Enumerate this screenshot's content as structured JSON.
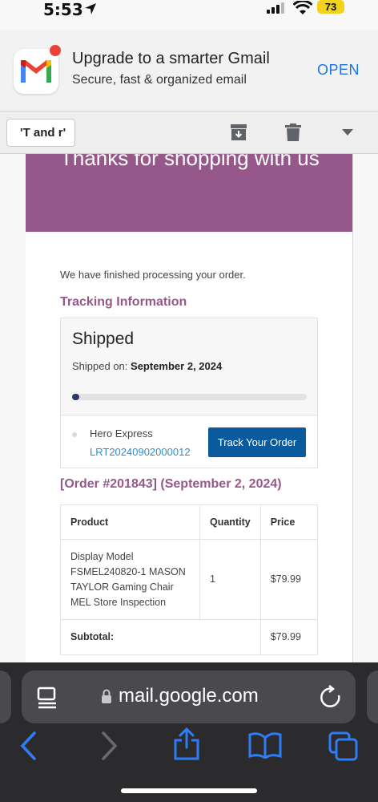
{
  "status_bar": {
    "time": "5:53",
    "battery": "73"
  },
  "app_banner": {
    "title": "Upgrade to a smarter Gmail",
    "subtitle": "Secure, fast & organized email",
    "open_label": "OPEN"
  },
  "toolbar": {
    "back_label": "'T and r'"
  },
  "email": {
    "hero_text": "Thanks for shopping with us",
    "intro": "We have finished processing your order.",
    "tracking_heading": "Tracking Information",
    "tracking": {
      "status": "Shipped",
      "shipped_on_label": "Shipped on:",
      "shipped_on_date": "September 2, 2024",
      "progress": 0.03,
      "carrier": "Hero Express",
      "tracking_number": "LRT20240902000012",
      "track_button": "Track Your Order"
    },
    "order_heading": "[Order #201843] (September 2, 2024)",
    "table": {
      "headers": [
        "Product",
        "Quantity",
        "Price"
      ],
      "rows": [
        {
          "product": "Display Model FSMEL240820-1 MASON TAYLOR Gaming Chair MEL Store Inspection",
          "quantity": "1",
          "price": "$79.99"
        }
      ],
      "subtotal_label": "Subtotal:",
      "subtotal_value": "$79.99"
    }
  },
  "browser": {
    "url": "mail.google.com"
  },
  "colors": {
    "brand_purple": "#96588a",
    "button_blue": "#0a5b9e",
    "link_blue": "#2f8fc9",
    "ios_blue": "#1a73e8"
  }
}
